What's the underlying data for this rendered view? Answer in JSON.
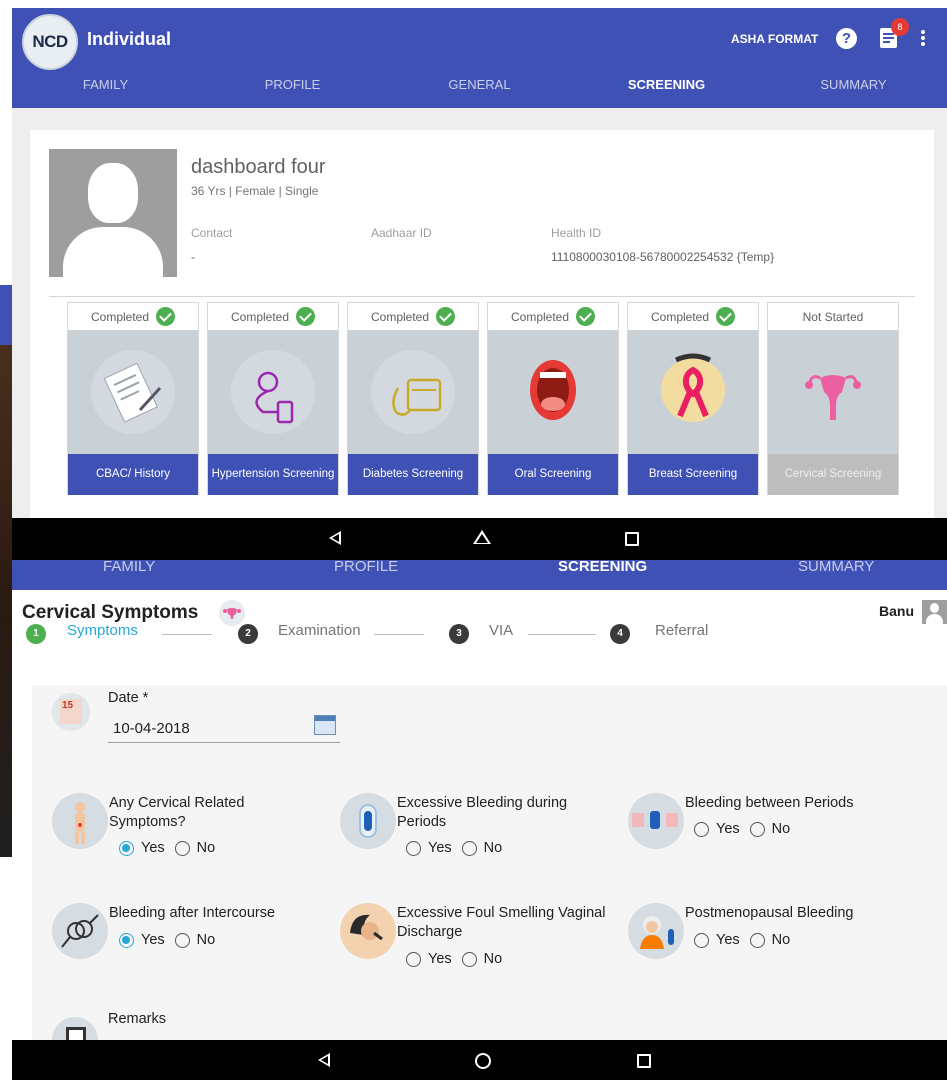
{
  "top_screen": {
    "app_logo": "NCD",
    "app_title": "Individual",
    "asha_format": "ASHA FORMAT",
    "notification_count": "8",
    "tabs": [
      "FAMILY",
      "PROFILE",
      "GENERAL",
      "SCREENING",
      "SUMMARY"
    ],
    "active_tab": "SCREENING",
    "profile": {
      "name": "dashboard four",
      "meta": "36 Yrs  |  Female |  Single",
      "contact_label": "Contact",
      "contact_value": "-",
      "aadhaar_label": "Aadhaar ID",
      "aadhaar_value": "",
      "health_id_label": "Health ID",
      "health_id_value": "1110800030108-56780002254532 {Temp}"
    },
    "screenings": [
      {
        "status": "Completed",
        "label": "CBAC/ History",
        "icon": "clipboard-icon"
      },
      {
        "status": "Completed",
        "label": "Hypertension Screening",
        "icon": "blood-pressure-icon"
      },
      {
        "status": "Completed",
        "label": "Diabetes Screening",
        "icon": "glucometer-icon"
      },
      {
        "status": "Completed",
        "label": "Oral Screening",
        "icon": "mouth-icon"
      },
      {
        "status": "Completed",
        "label": "Breast Screening",
        "icon": "pink-ribbon-icon"
      },
      {
        "status": "Not Started",
        "label": "Cervical Screening",
        "icon": "uterus-icon"
      }
    ]
  },
  "bottom_screen": {
    "tabs": [
      "FAMILY",
      "PROFILE",
      "SCREENING",
      "SUMMARY"
    ],
    "active_tab": "SCREENING",
    "title": "Cervical Symptoms",
    "user_name": "Banu",
    "steps": [
      {
        "num": "1",
        "label": "Symptoms"
      },
      {
        "num": "2",
        "label": "Examination"
      },
      {
        "num": "3",
        "label": "VIA"
      },
      {
        "num": "4",
        "label": "Referral"
      }
    ],
    "date_label": "Date *",
    "date_icon_text": "15",
    "date_value": "10-04-2018",
    "yes_label": "Yes",
    "no_label": "No",
    "questions": [
      {
        "line1": "Any Cervical Related",
        "line2": "Symptoms?",
        "answer": "Yes"
      },
      {
        "line1": "Excessive Bleeding during",
        "line2": "Periods",
        "answer": "none"
      },
      {
        "line1": "Bleeding between Periods",
        "line2": "",
        "answer": "none"
      },
      {
        "line1": "Bleeding after Intercourse",
        "line2": "",
        "answer": "Yes"
      },
      {
        "line1": "Excessive Foul Smelling Vaginal",
        "line2": "Discharge",
        "answer": "none"
      },
      {
        "line1": "Postmenopausal Bleeding",
        "line2": "",
        "answer": "none"
      }
    ],
    "remarks_label": "Remarks"
  },
  "colors": {
    "primary": "#3f51b5",
    "accent": "#29a8d8",
    "success": "#4caf50",
    "badge": "#e53935"
  }
}
